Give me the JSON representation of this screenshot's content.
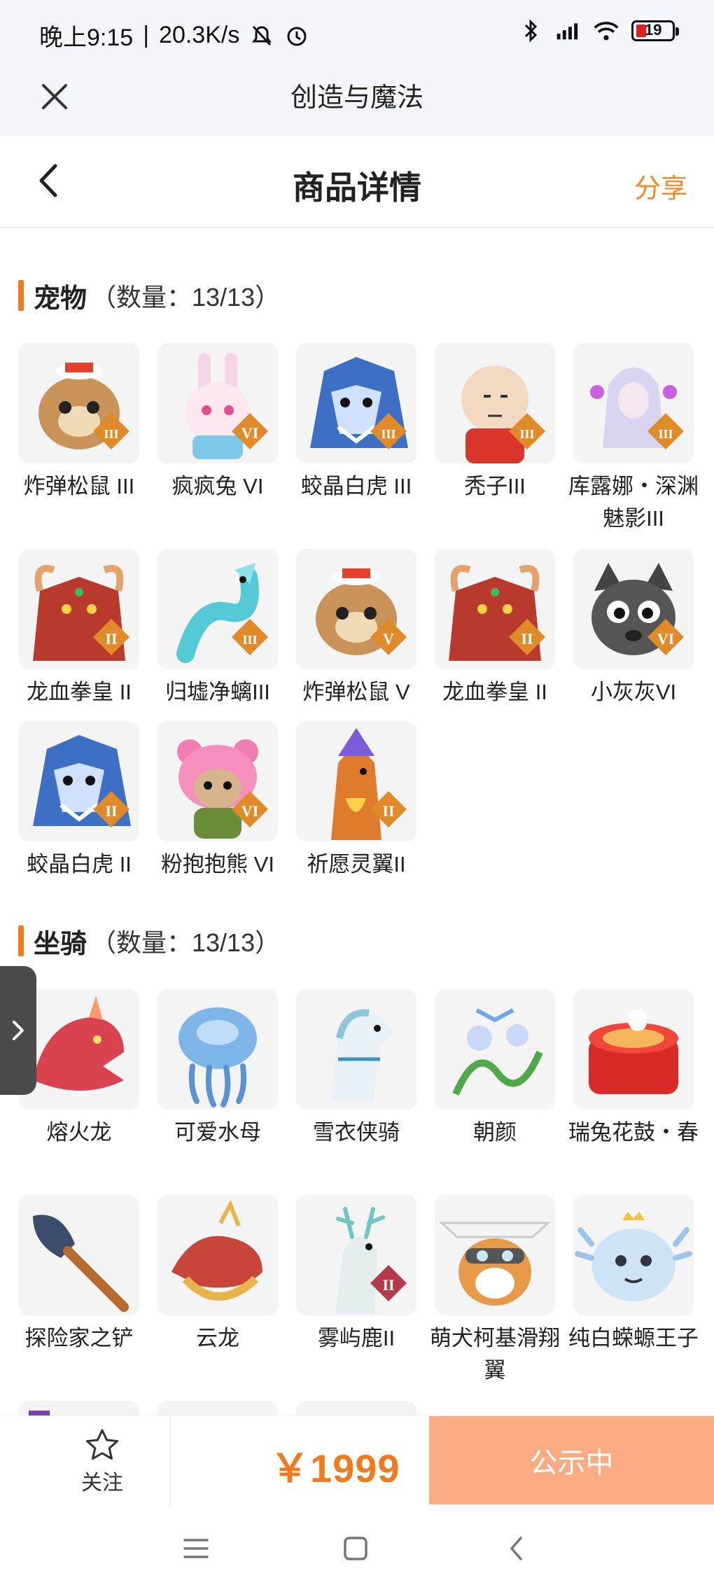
{
  "status_bar": {
    "time": "晚上9:15",
    "speed": "20.3K/s",
    "battery": "19",
    "icons": [
      "mute-icon",
      "alarm-icon",
      "bluetooth-icon",
      "signal-icon",
      "wifi-icon",
      "battery-icon"
    ]
  },
  "app": {
    "title": "创造与魔法"
  },
  "page": {
    "title": "商品详情",
    "share_label": "分享"
  },
  "pets": {
    "name": "宠物",
    "count": "（数量：13/13）",
    "items": [
      {
        "label": "炸弹松鼠 III",
        "icon": "squirrel",
        "badge": "III"
      },
      {
        "label": "疯疯兔 VI",
        "icon": "rabbit",
        "badge": "VI"
      },
      {
        "label": "蛟晶白虎 III",
        "icon": "tiger",
        "badge": "III"
      },
      {
        "label": "秃子III",
        "icon": "bald-figure",
        "badge": "III"
      },
      {
        "label": "库露娜・深渊魅影III",
        "icon": "spirit-girl",
        "badge": "III"
      },
      {
        "label": "龙血拳皇 II",
        "icon": "dragon-boxer",
        "badge": "II"
      },
      {
        "label": "归墟净螭III",
        "icon": "cyan-dragon",
        "badge": "III"
      },
      {
        "label": "炸弹松鼠 V",
        "icon": "squirrel",
        "badge": "V"
      },
      {
        "label": "龙血拳皇 II",
        "icon": "dragon-boxer",
        "badge": "II"
      },
      {
        "label": "小灰灰VI",
        "icon": "gray-wolf",
        "badge": "VI"
      },
      {
        "label": "蛟晶白虎 II",
        "icon": "tiger",
        "badge": "II"
      },
      {
        "label": "粉抱抱熊 VI",
        "icon": "pink-bear",
        "badge": "VI"
      },
      {
        "label": "祈愿灵翼II",
        "icon": "phoenix",
        "badge": "II"
      }
    ]
  },
  "mounts": {
    "name": "坐骑",
    "count": "（数量：13/13）",
    "items": [
      {
        "label": "熔火龙",
        "icon": "fire-dragon",
        "badge": ""
      },
      {
        "label": "可爱水母",
        "icon": "jellyfish",
        "badge": ""
      },
      {
        "label": "雪衣侠骑",
        "icon": "white-horse",
        "badge": ""
      },
      {
        "label": "朝颜",
        "icon": "vine-flower",
        "badge": ""
      },
      {
        "label": "瑞兔花鼓・春",
        "icon": "drum",
        "badge": ""
      },
      {
        "label": "探险家之铲",
        "icon": "shovel",
        "badge": ""
      },
      {
        "label": "云龙",
        "icon": "cloud-dragon",
        "badge": ""
      },
      {
        "label": "雾屿鹿II",
        "icon": "deer",
        "badge": "II"
      },
      {
        "label": "萌犬柯基滑翔翼",
        "icon": "corgi-glider",
        "badge": ""
      },
      {
        "label": "纯白蝾螈王子",
        "icon": "axolotl",
        "badge": ""
      }
    ]
  },
  "bottom": {
    "follow_label": "关注",
    "price": "￥1999",
    "status_label": "公示中"
  },
  "colors": {
    "accent": "#f07a1c",
    "publish_bg": "#f9ab82",
    "badge": "#e08a2a"
  }
}
